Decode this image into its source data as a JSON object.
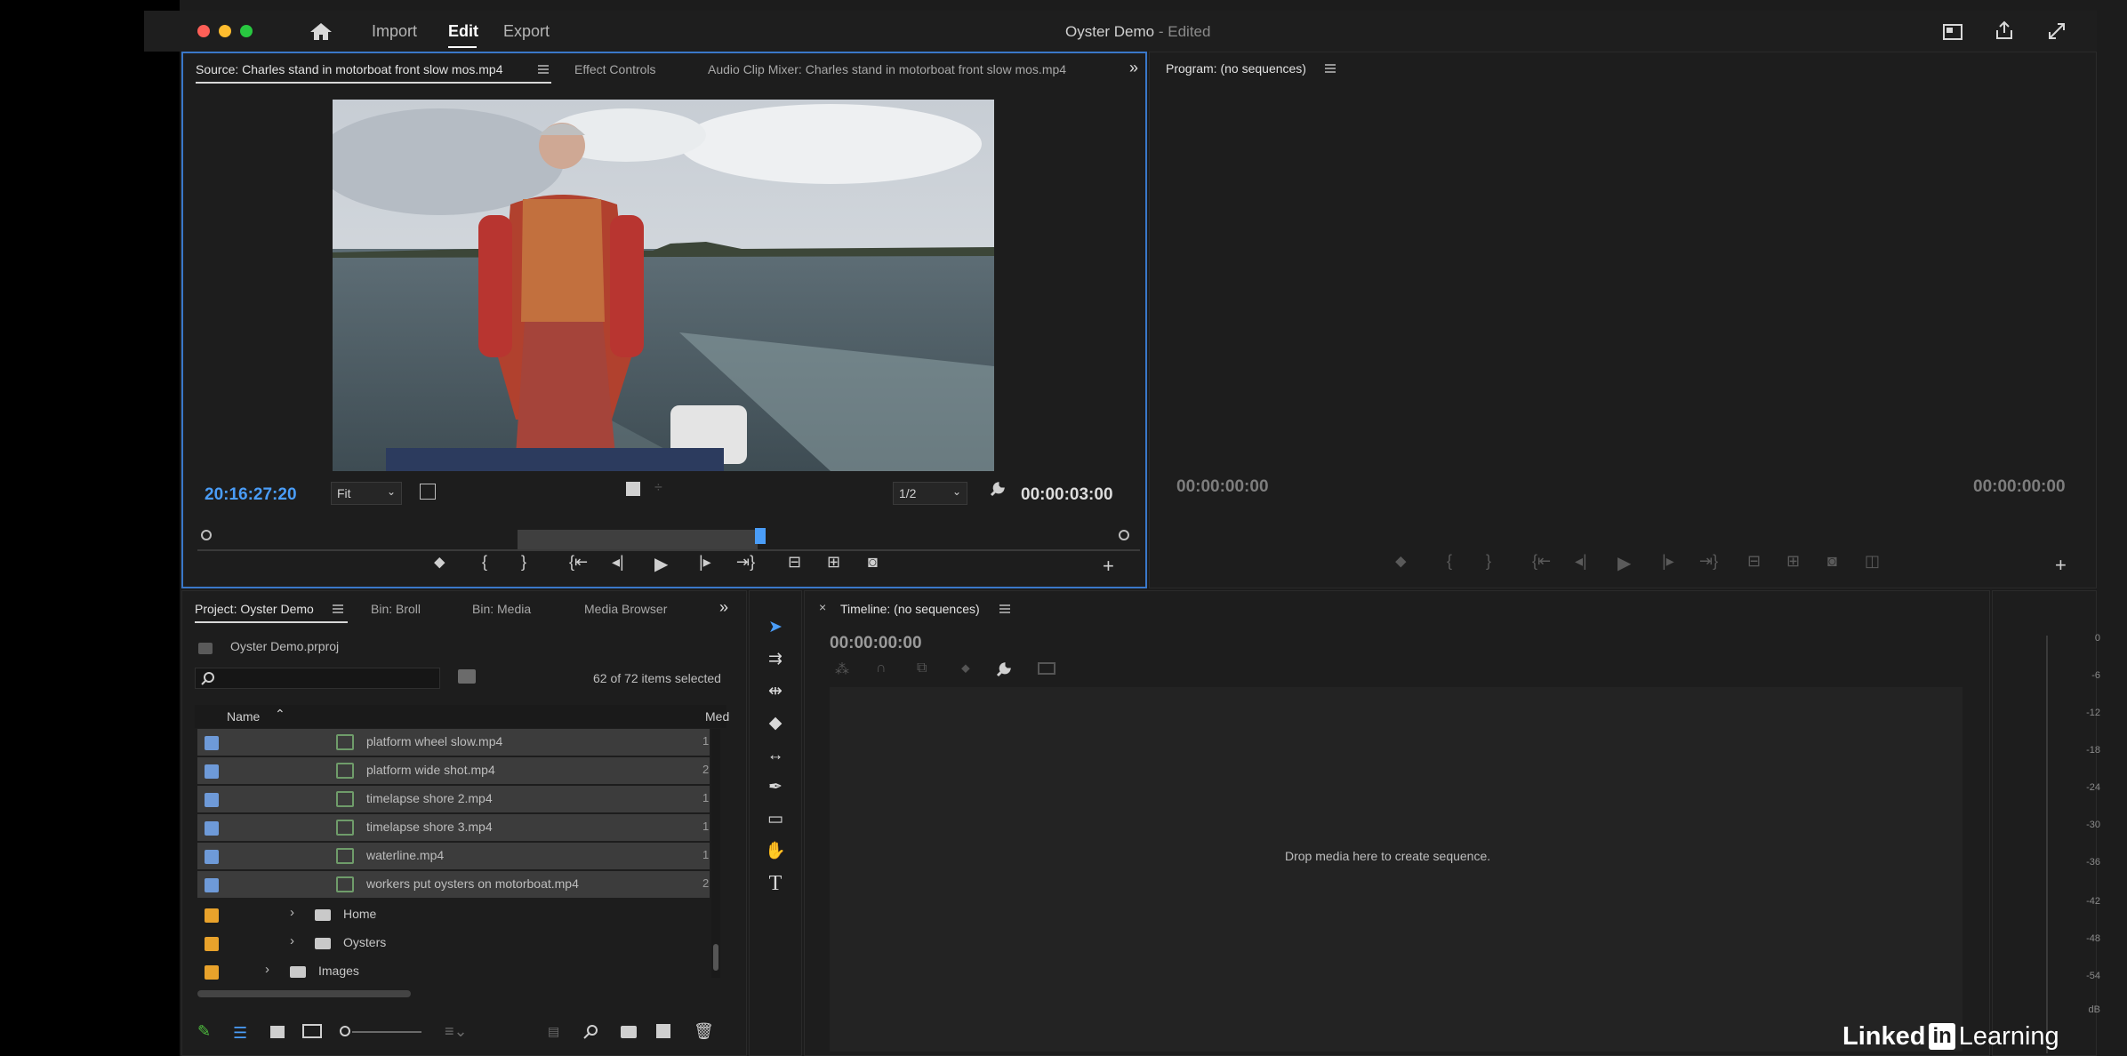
{
  "window": {
    "title": "Oyster Demo",
    "title_suffix": " - Edited",
    "nav": {
      "import": "Import",
      "edit": "Edit",
      "export": "Export"
    }
  },
  "source_panel": {
    "tabs": {
      "source": "Source: Charles stand in motorboat front slow mos.mp4",
      "effect_controls": "Effect Controls",
      "audio_mixer": "Audio Clip Mixer: Charles stand in motorboat front slow mos.mp4",
      "overflow": "»"
    },
    "timecode_current": "20:16:27:20",
    "zoom_select": "Fit",
    "resolution_select": "1/2",
    "duration": "00:00:03:00"
  },
  "program_panel": {
    "tab": "Program: (no sequences)",
    "timecode_left": "00:00:00:00",
    "timecode_right": "00:00:00:00"
  },
  "project_panel": {
    "tabs": {
      "project": "Project: Oyster Demo",
      "broll": "Bin: Broll",
      "media": "Bin: Media",
      "browser": "Media Browser",
      "overflow": "»"
    },
    "project_file": "Oyster Demo.prproj",
    "items_selected": "62 of 72 items selected",
    "columns": {
      "name": "Name",
      "media": "Med"
    },
    "files": [
      {
        "name": "platform wheel slow.mp4",
        "media": "1"
      },
      {
        "name": "platform wide shot.mp4",
        "media": "2"
      },
      {
        "name": "timelapse shore 2.mp4",
        "media": "1"
      },
      {
        "name": "timelapse shore 3.mp4",
        "media": "1"
      },
      {
        "name": "waterline.mp4",
        "media": "1"
      },
      {
        "name": "workers put oysters on motorboat.mp4",
        "media": "2"
      }
    ],
    "folders": [
      {
        "name": "Home"
      },
      {
        "name": "Oysters"
      },
      {
        "name": "Images"
      }
    ]
  },
  "timeline_panel": {
    "tab": "Timeline: (no sequences)",
    "timecode": "00:00:00:00",
    "drop_hint": "Drop media here to create sequence."
  },
  "audio_meter": {
    "ticks": [
      "0",
      "-6",
      "-12",
      "-18",
      "-24",
      "-30",
      "-36",
      "-42",
      "-48",
      "-54",
      "dB"
    ]
  },
  "watermark": {
    "linked": "Linked",
    "in": "in",
    "learning": "Learning"
  },
  "colors": {
    "accent_blue": "#4a9df8",
    "selection_swatch": "#6e9ad8",
    "folder_swatch": "#e8a22b",
    "panel_bg": "#1d1d1d"
  }
}
